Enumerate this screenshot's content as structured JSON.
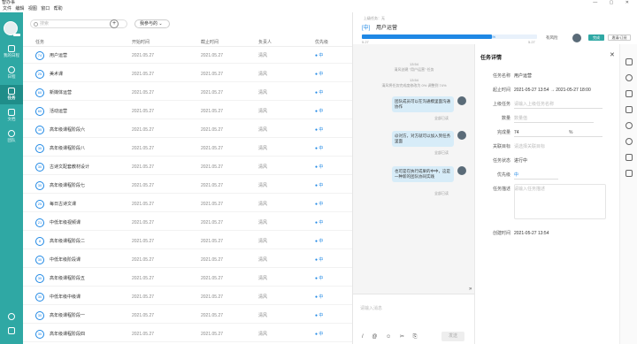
{
  "app": {
    "title": "智办事"
  },
  "menu": [
    "文件",
    "编辑",
    "视图",
    "窗口",
    "帮助"
  ],
  "sidebar": {
    "items": [
      {
        "label": "我的日程"
      },
      {
        "label": "日程"
      },
      {
        "label": "任务"
      },
      {
        "label": "文档"
      },
      {
        "label": "团队"
      }
    ]
  },
  "list": {
    "search_placeholder": "搜索",
    "add_label": "+",
    "filter_label": "我参与的",
    "columns": [
      "任务",
      "开始时间",
      "截止时间",
      "负责人",
      "优先级"
    ],
    "rows": [
      {
        "pct": "74",
        "name": "用户运营",
        "start": "2021.05.27",
        "end": "2021.05.27",
        "owner": "清风",
        "priority": "中"
      },
      {
        "pct": "25",
        "name": "美术课",
        "start": "2021.05.27",
        "end": "2021.05.27",
        "owner": "清风",
        "priority": "中"
      },
      {
        "pct": "60",
        "name": "新媒体运营",
        "start": "2021.05.27",
        "end": "2021.05.27",
        "owner": "清风",
        "priority": "中"
      },
      {
        "pct": "60",
        "name": "活动运营",
        "start": "2021.05.27",
        "end": "2021.05.27",
        "owner": "清风",
        "priority": "中"
      },
      {
        "pct": "30",
        "name": "高年级课程阶段六",
        "start": "2021.05.27",
        "end": "2021.05.27",
        "owner": "清风",
        "priority": "中"
      },
      {
        "pct": "30",
        "name": "高年级课程阶段八",
        "start": "2021.05.27",
        "end": "2021.05.27",
        "owner": "清风",
        "priority": "中"
      },
      {
        "pct": "30",
        "name": "古诗文配套教材设计",
        "start": "2021.05.27",
        "end": "2021.05.27",
        "owner": "清风",
        "priority": "中"
      },
      {
        "pct": "30",
        "name": "高年级课程阶段七",
        "start": "2021.05.27",
        "end": "2021.05.27",
        "owner": "清风",
        "priority": "中"
      },
      {
        "pct": "25",
        "name": "每日古诗文课",
        "start": "2021.05.27",
        "end": "2021.05.27",
        "owner": "清风",
        "priority": "中"
      },
      {
        "pct": "21",
        "name": "中低年级视频课",
        "start": "2021.05.27",
        "end": "2021.05.27",
        "owner": "清风",
        "priority": "中"
      },
      {
        "pct": "8",
        "name": "高年级课程阶段二",
        "start": "2021.05.27",
        "end": "2021.05.27",
        "owner": "清风",
        "priority": "中"
      },
      {
        "pct": "30",
        "name": "中低年级阶段课",
        "start": "2021.05.27",
        "end": "2021.05.27",
        "owner": "清风",
        "priority": "中"
      },
      {
        "pct": "30",
        "name": "高年级课程阶段五",
        "start": "2021.05.27",
        "end": "2021.05.27",
        "owner": "清风",
        "priority": "中"
      },
      {
        "pct": "30",
        "name": "中低年级中级课",
        "start": "2021.05.27",
        "end": "2021.05.27",
        "owner": "清风",
        "priority": "中"
      },
      {
        "pct": "30",
        "name": "高年级课程阶段一",
        "start": "2021.05.27",
        "end": "2021.05.27",
        "owner": "清风",
        "priority": "中"
      },
      {
        "pct": "30",
        "name": "高年级课程阶段四",
        "start": "2021.05.27",
        "end": "2021.05.27",
        "owner": "清风",
        "priority": "中"
      }
    ]
  },
  "chat": {
    "parent_label": "上级任务：无",
    "title_tag": "[中]",
    "title": "用户运营",
    "progress_label": "进行中 74%",
    "progress_value": 0.74,
    "date_left": "5.27",
    "date_right": "5.27",
    "risk_label": "有风险",
    "done_btn": "完成",
    "share_btn": "邀请/订阅",
    "messages": [
      {
        "time": "13:54",
        "sys": "清风创建 \"用户运营\" 任务"
      },
      {
        "time": "13:54",
        "sys": "清风将任务完成度修改为 0% 调整到 74%"
      }
    ],
    "bubbles": [
      {
        "text": "团队成员可以在沟通模里面沟通协作",
        "read": "全部已读"
      },
      {
        "text": "@对方，对方就可以加入到任务里面",
        "read": "全部已读"
      },
      {
        "text": "也可是在执行成果的中中，这是一种新的团队协同实践",
        "read": "全部已读"
      }
    ],
    "input_placeholder": "请输入消息",
    "send_label": "发送"
  },
  "detail": {
    "header": "任务详情",
    "fields": [
      {
        "label": "任务名称",
        "value": "用户运营"
      },
      {
        "label": "起止时间",
        "value": "2021-05-27 13:54   →   2021-05-27 18:00"
      },
      {
        "label": "上级任务",
        "value": "请输入上级任务名称"
      },
      {
        "label": "数量",
        "value": "数量值"
      },
      {
        "label": "完成量",
        "value": "74"
      },
      {
        "label": "关联目标",
        "value": "请选择关联目标"
      },
      {
        "label": "任务状态",
        "value": "进行中"
      },
      {
        "label": "优先级",
        "value": "中"
      },
      {
        "label": "任务描述",
        "value": "请输入任务描述"
      },
      {
        "label": "创建时间",
        "value": "2021-05-27 13:54"
      }
    ]
  }
}
